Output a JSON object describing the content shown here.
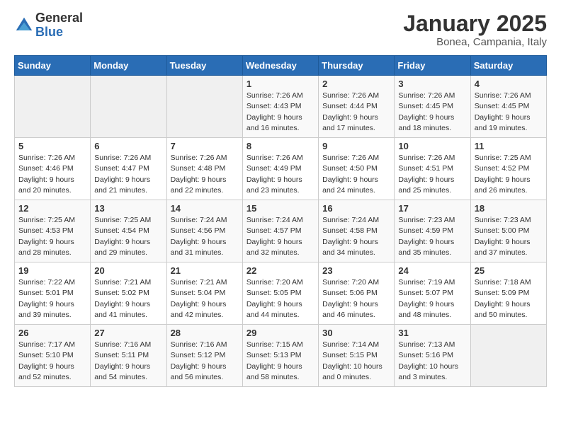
{
  "logo": {
    "general": "General",
    "blue": "Blue"
  },
  "header": {
    "month": "January 2025",
    "location": "Bonea, Campania, Italy"
  },
  "days_of_week": [
    "Sunday",
    "Monday",
    "Tuesday",
    "Wednesday",
    "Thursday",
    "Friday",
    "Saturday"
  ],
  "weeks": [
    [
      {
        "day": "",
        "info": ""
      },
      {
        "day": "",
        "info": ""
      },
      {
        "day": "",
        "info": ""
      },
      {
        "day": "1",
        "info": "Sunrise: 7:26 AM\nSunset: 4:43 PM\nDaylight: 9 hours\nand 16 minutes."
      },
      {
        "day": "2",
        "info": "Sunrise: 7:26 AM\nSunset: 4:44 PM\nDaylight: 9 hours\nand 17 minutes."
      },
      {
        "day": "3",
        "info": "Sunrise: 7:26 AM\nSunset: 4:45 PM\nDaylight: 9 hours\nand 18 minutes."
      },
      {
        "day": "4",
        "info": "Sunrise: 7:26 AM\nSunset: 4:45 PM\nDaylight: 9 hours\nand 19 minutes."
      }
    ],
    [
      {
        "day": "5",
        "info": "Sunrise: 7:26 AM\nSunset: 4:46 PM\nDaylight: 9 hours\nand 20 minutes."
      },
      {
        "day": "6",
        "info": "Sunrise: 7:26 AM\nSunset: 4:47 PM\nDaylight: 9 hours\nand 21 minutes."
      },
      {
        "day": "7",
        "info": "Sunrise: 7:26 AM\nSunset: 4:48 PM\nDaylight: 9 hours\nand 22 minutes."
      },
      {
        "day": "8",
        "info": "Sunrise: 7:26 AM\nSunset: 4:49 PM\nDaylight: 9 hours\nand 23 minutes."
      },
      {
        "day": "9",
        "info": "Sunrise: 7:26 AM\nSunset: 4:50 PM\nDaylight: 9 hours\nand 24 minutes."
      },
      {
        "day": "10",
        "info": "Sunrise: 7:26 AM\nSunset: 4:51 PM\nDaylight: 9 hours\nand 25 minutes."
      },
      {
        "day": "11",
        "info": "Sunrise: 7:25 AM\nSunset: 4:52 PM\nDaylight: 9 hours\nand 26 minutes."
      }
    ],
    [
      {
        "day": "12",
        "info": "Sunrise: 7:25 AM\nSunset: 4:53 PM\nDaylight: 9 hours\nand 28 minutes."
      },
      {
        "day": "13",
        "info": "Sunrise: 7:25 AM\nSunset: 4:54 PM\nDaylight: 9 hours\nand 29 minutes."
      },
      {
        "day": "14",
        "info": "Sunrise: 7:24 AM\nSunset: 4:56 PM\nDaylight: 9 hours\nand 31 minutes."
      },
      {
        "day": "15",
        "info": "Sunrise: 7:24 AM\nSunset: 4:57 PM\nDaylight: 9 hours\nand 32 minutes."
      },
      {
        "day": "16",
        "info": "Sunrise: 7:24 AM\nSunset: 4:58 PM\nDaylight: 9 hours\nand 34 minutes."
      },
      {
        "day": "17",
        "info": "Sunrise: 7:23 AM\nSunset: 4:59 PM\nDaylight: 9 hours\nand 35 minutes."
      },
      {
        "day": "18",
        "info": "Sunrise: 7:23 AM\nSunset: 5:00 PM\nDaylight: 9 hours\nand 37 minutes."
      }
    ],
    [
      {
        "day": "19",
        "info": "Sunrise: 7:22 AM\nSunset: 5:01 PM\nDaylight: 9 hours\nand 39 minutes."
      },
      {
        "day": "20",
        "info": "Sunrise: 7:21 AM\nSunset: 5:02 PM\nDaylight: 9 hours\nand 41 minutes."
      },
      {
        "day": "21",
        "info": "Sunrise: 7:21 AM\nSunset: 5:04 PM\nDaylight: 9 hours\nand 42 minutes."
      },
      {
        "day": "22",
        "info": "Sunrise: 7:20 AM\nSunset: 5:05 PM\nDaylight: 9 hours\nand 44 minutes."
      },
      {
        "day": "23",
        "info": "Sunrise: 7:20 AM\nSunset: 5:06 PM\nDaylight: 9 hours\nand 46 minutes."
      },
      {
        "day": "24",
        "info": "Sunrise: 7:19 AM\nSunset: 5:07 PM\nDaylight: 9 hours\nand 48 minutes."
      },
      {
        "day": "25",
        "info": "Sunrise: 7:18 AM\nSunset: 5:09 PM\nDaylight: 9 hours\nand 50 minutes."
      }
    ],
    [
      {
        "day": "26",
        "info": "Sunrise: 7:17 AM\nSunset: 5:10 PM\nDaylight: 9 hours\nand 52 minutes."
      },
      {
        "day": "27",
        "info": "Sunrise: 7:16 AM\nSunset: 5:11 PM\nDaylight: 9 hours\nand 54 minutes."
      },
      {
        "day": "28",
        "info": "Sunrise: 7:16 AM\nSunset: 5:12 PM\nDaylight: 9 hours\nand 56 minutes."
      },
      {
        "day": "29",
        "info": "Sunrise: 7:15 AM\nSunset: 5:13 PM\nDaylight: 9 hours\nand 58 minutes."
      },
      {
        "day": "30",
        "info": "Sunrise: 7:14 AM\nSunset: 5:15 PM\nDaylight: 10 hours\nand 0 minutes."
      },
      {
        "day": "31",
        "info": "Sunrise: 7:13 AM\nSunset: 5:16 PM\nDaylight: 10 hours\nand 3 minutes."
      },
      {
        "day": "",
        "info": ""
      }
    ]
  ]
}
